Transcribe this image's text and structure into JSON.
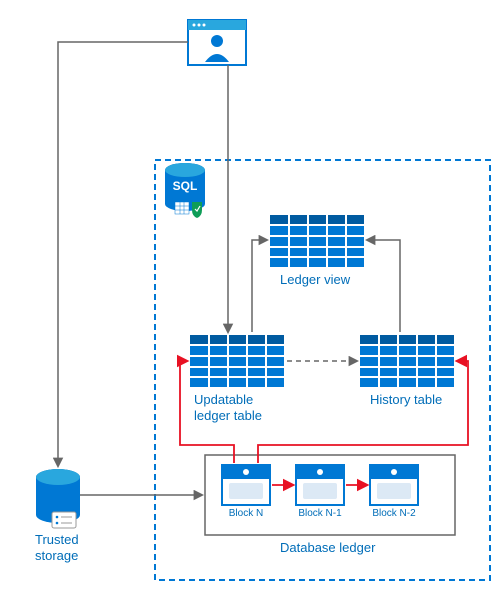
{
  "diagram": {
    "sql_badge": "SQL",
    "ledger_view": "Ledger view",
    "updatable_table": "Updatable\nledger table",
    "history_table": "History table",
    "block_n": "Block N",
    "block_n1": "Block N-1",
    "block_n2": "Block N-2",
    "database_ledger": "Database ledger",
    "trusted_storage": "Trusted\nstorage",
    "colors": {
      "azure_blue": "#0078d4",
      "azure_dark": "#005ba1",
      "label_blue": "#006db8",
      "gray_arrow": "#666666",
      "red_arrow": "#e81123",
      "dash_blue": "#0078d4"
    }
  }
}
